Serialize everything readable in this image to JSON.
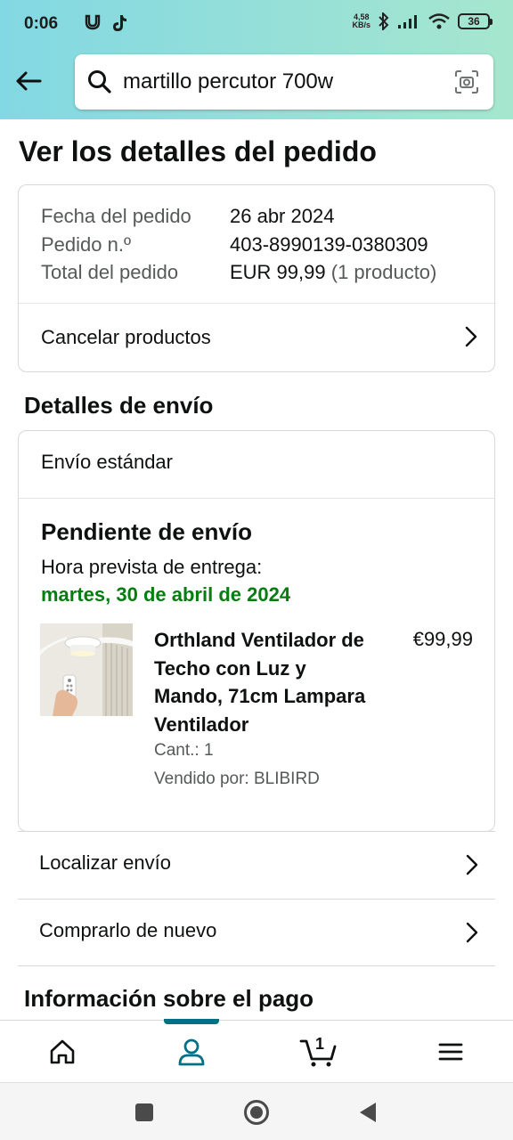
{
  "status_bar": {
    "time": "0:06",
    "net_speed_value": "4,58",
    "net_speed_unit": "KB/s",
    "battery": "36"
  },
  "search": {
    "value": "martillo percutor 700w"
  },
  "page": {
    "title": "Ver los detalles del pedido"
  },
  "order_summary": {
    "date_label": "Fecha del pedido",
    "date_value": "26 abr 2024",
    "order_no_label": "Pedido n.º",
    "order_no_value": "403-8990139-0380309",
    "total_label": "Total del pedido",
    "total_value": "EUR 99,99",
    "total_items": "(1 producto)",
    "cancel_label": "Cancelar productos"
  },
  "shipping": {
    "section_title": "Detalles de envío",
    "method": "Envío estándar",
    "status": "Pendiente de envío",
    "eta_label": "Hora prevista de entrega:",
    "eta_date": "martes, 30 de abril de 2024",
    "product": {
      "title": "Orthland Ventilador de Techo con Luz y Mando, 71cm Lampara Ventilador",
      "price": "€99,99",
      "qty": "Cant.: 1",
      "seller": "Vendido por: BLIBIRD"
    }
  },
  "actions": {
    "track": "Localizar envío",
    "buy_again": "Comprarlo de nuevo"
  },
  "payment": {
    "section_title": "Información sobre el pago"
  },
  "bottom_nav": {
    "cart_count": "1",
    "active": "account"
  },
  "colors": {
    "accent": "#007185",
    "delivery_green": "#067d10",
    "header_start": "#82d8e3",
    "header_end": "#a6e6ce"
  }
}
